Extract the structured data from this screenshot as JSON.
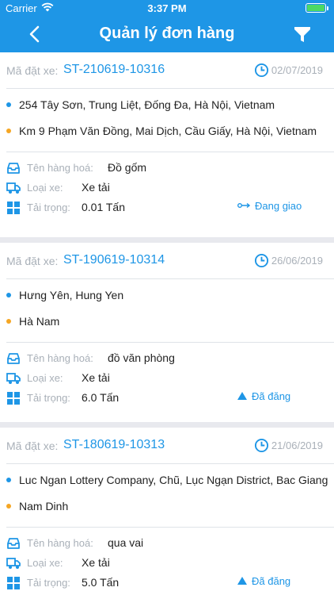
{
  "status_bar": {
    "carrier": "Carrier",
    "time": "3:37 PM"
  },
  "nav": {
    "title": "Quản lý đơn hàng"
  },
  "labels": {
    "order_code": "Mã đặt xe:",
    "goods": "Tên hàng hoá:",
    "vehicle": "Loại xe:",
    "load": "Tải trọng:"
  },
  "orders": [
    {
      "code": "ST-210619-10316",
      "date": "02/07/2019",
      "pickup": "254 Tây Sơn, Trung Liệt, Đống Đa, Hà Nội, Vietnam",
      "dropoff": "Km 9 Phạm Văn Đồng, Mai Dịch, Cầu Giấy, Hà Nội, Vietnam",
      "goods": "Đồ gốm",
      "vehicle": "Xe tải",
      "load": "0.01 Tấn",
      "status": "Đang giao",
      "status_icon": "delivering-icon"
    },
    {
      "code": "ST-190619-10314",
      "date": "26/06/2019",
      "pickup": "Hưng Yên, Hung Yen",
      "dropoff": "Hà Nam",
      "goods": "đồ văn phòng",
      "vehicle": "Xe tải",
      "load": "6.0 Tấn",
      "status": "Đã đăng",
      "status_icon": "posted-triangle-icon"
    },
    {
      "code": "ST-180619-10313",
      "date": "21/06/2019",
      "pickup": "Luc Ngan Lottery Company, Chũ, Lục Ngạn District, Bac Giang",
      "dropoff": "Nam Dinh",
      "goods": "qua vai",
      "vehicle": "Xe tải",
      "load": "5.0 Tấn",
      "status": "Đã đăng",
      "status_icon": "posted-triangle-icon"
    }
  ],
  "colors": {
    "primary": "#1e96e6",
    "muted": "#a9b0b8",
    "pickup_dot": "#1e96e6",
    "dropoff_dot": "#f5a623",
    "battery": "#4cd964"
  }
}
